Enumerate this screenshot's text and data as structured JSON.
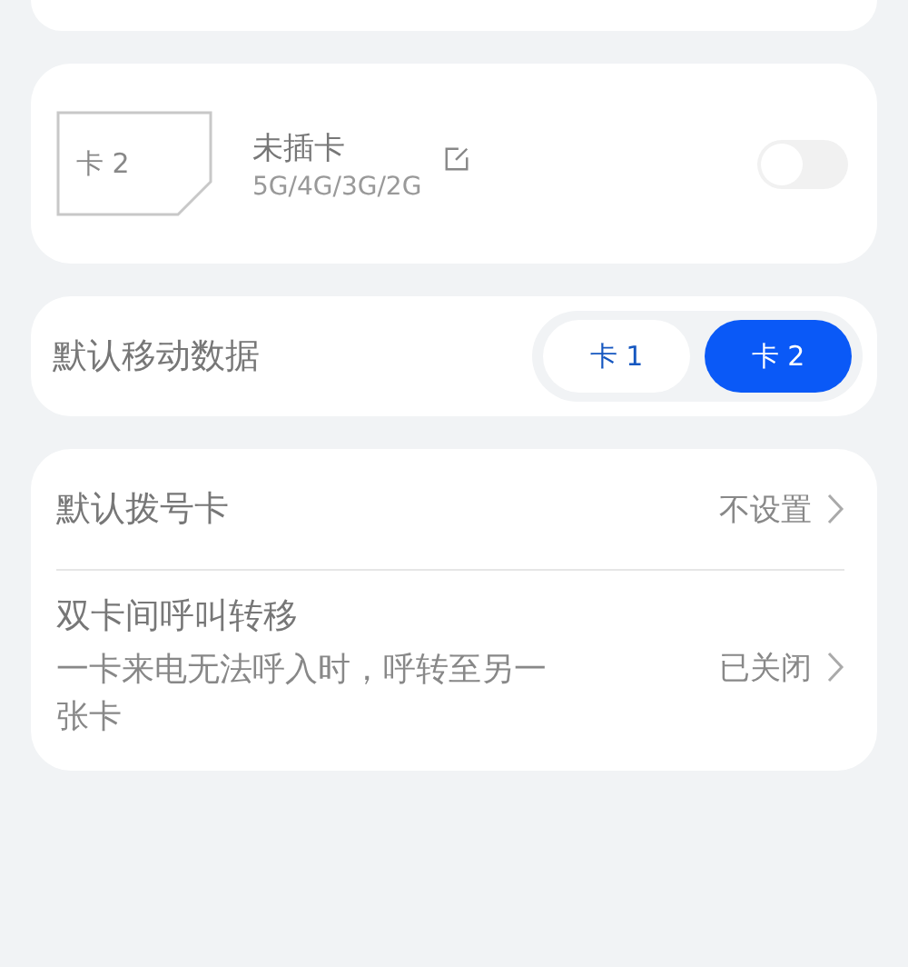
{
  "sim_card": {
    "slot_label": "卡 2",
    "status": "未插卡",
    "network": "5G/4G/3G/2G",
    "on": false
  },
  "default_data": {
    "label": "默认移动数据",
    "options": [
      {
        "label": "卡 1",
        "selected": false
      },
      {
        "label": "卡 2",
        "selected": true
      }
    ]
  },
  "settings": [
    {
      "title": "默认拨号卡",
      "value": "不设置"
    },
    {
      "title": "双卡间呼叫转移",
      "description": "一卡来电无法呼入时，呼转至另一张卡",
      "value": "已关闭"
    }
  ]
}
